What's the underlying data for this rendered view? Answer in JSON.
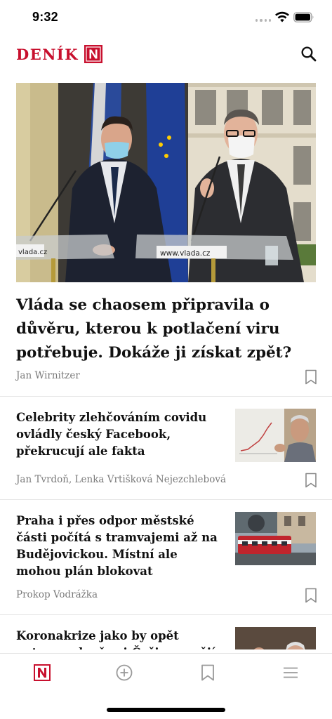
{
  "status_bar": {
    "time": "9:32"
  },
  "header": {
    "logo_text": "DENÍK",
    "logo_mark": "N",
    "search_icon": "search-icon"
  },
  "hero": {
    "image_caption_left": "vlada.cz",
    "image_caption_right": "www.vlada.cz",
    "title": "Vláda se chaosem připravila o důvěru, kterou k potlačení viru potřebuje. Dokáže ji získat zpět?",
    "author": "Jan Wirnitzer"
  },
  "articles": [
    {
      "title": "Celebrity zlehčováním covidu ovládly český Facebook, překrucují ale fakta",
      "author": "Jan Tvrdoň, Lenka Vrtišková Nejezchlebová"
    },
    {
      "title": "Praha i přes odpor městské části počítá s tramvajemi až na Budějovickou. Místní ale mohou plán blokovat",
      "author": "Prokop Vodrážka"
    },
    {
      "title": "Koronakrize jako by opět potvrzovala, že si Češi neumějí",
      "author": ""
    }
  ],
  "tab_bar": {
    "tabs": [
      {
        "name": "home",
        "icon": "denik-n-icon",
        "active": true
      },
      {
        "name": "add",
        "icon": "plus-circle-icon",
        "active": false
      },
      {
        "name": "saved",
        "icon": "bookmark-icon",
        "active": false
      },
      {
        "name": "menu",
        "icon": "hamburger-icon",
        "active": false
      }
    ]
  },
  "colors": {
    "brand": "#c8102e",
    "muted": "#7a7a7a",
    "divider": "#e6e6e6"
  }
}
